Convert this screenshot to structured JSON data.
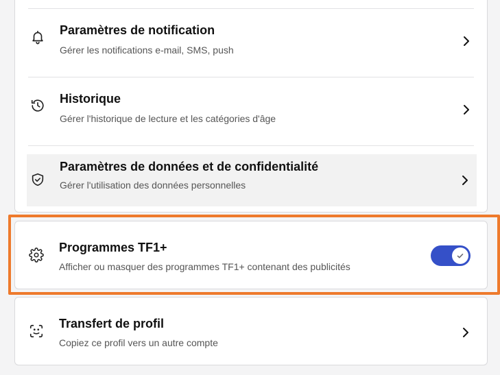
{
  "settings": {
    "items": [
      {
        "title": "Paramètres de notification",
        "subtitle": "Gérer les notifications e-mail, SMS, push",
        "icon": "bell-icon"
      },
      {
        "title": "Historique",
        "subtitle": "Gérer l'historique de lecture et les catégories d'âge",
        "icon": "history-icon"
      },
      {
        "title": "Paramètres de données et de confidentialité",
        "subtitle": "Gérer l'utilisation des données personnelles",
        "icon": "shield-check-icon"
      }
    ],
    "tf1": {
      "title": "Programmes TF1+",
      "subtitle": "Afficher ou masquer des programmes TF1+ contenant des publicités",
      "icon": "gear-icon",
      "toggle_on": true
    },
    "transfer": {
      "title": "Transfert de profil",
      "subtitle": "Copiez ce profil vers un autre compte",
      "icon": "profile-transfer-icon"
    }
  },
  "colors": {
    "toggle_on": "#3550c8",
    "focus_outline": "#ee7a2c",
    "highlight_row": "#f2f2f2"
  }
}
